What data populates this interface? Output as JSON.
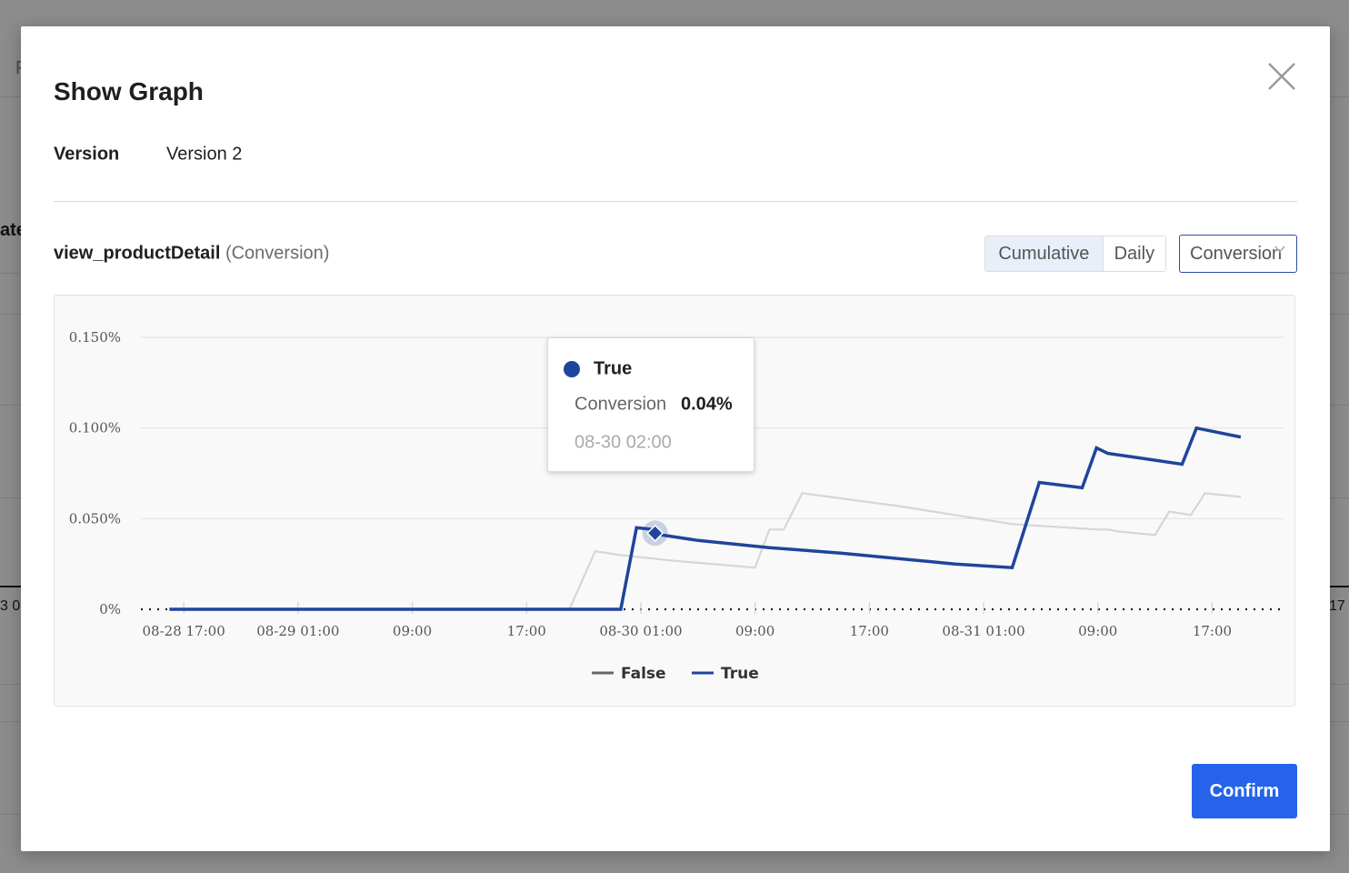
{
  "background": {
    "fragments": [
      "F",
      "ate",
      "3 0",
      "17"
    ]
  },
  "modal": {
    "title": "Show Graph",
    "version_label": "Version",
    "version_value": "Version 2",
    "metric_name": "view_productDetail",
    "metric_type": "(Conversion)",
    "segments": [
      "Cumulative",
      "Daily"
    ],
    "active_segment": "Cumulative",
    "select_value": "Conversion",
    "confirm_label": "Confirm"
  },
  "tooltip": {
    "series": "True",
    "metric": "Conversion",
    "value": "0.04%",
    "time": "08-30 02:00"
  },
  "icons": {
    "close": "close-icon",
    "chevron": "chevron-down-icon",
    "legend_line": "line-marker-icon"
  },
  "colors": {
    "accent": "#2563eb",
    "series_true": "#1f449b",
    "series_false": "#d6d6d6",
    "legend_false": "#666666"
  },
  "chart_data": {
    "type": "line",
    "x_tick_labels": [
      "08-28 17:00",
      "08-29 01:00",
      "09:00",
      "17:00",
      "08-30 01:00",
      "09:00",
      "17:00",
      "08-31 01:00",
      "09:00",
      "17:00"
    ],
    "x_tick_hours": [
      0,
      8,
      16,
      24,
      32,
      40,
      48,
      56,
      64,
      72
    ],
    "xlim": [
      -3,
      77
    ],
    "y_tick_labels": [
      "0%",
      "0.050%",
      "0.100%",
      "0.150%"
    ],
    "y_tick_values": [
      0,
      0.05,
      0.1,
      0.15
    ],
    "ylim": [
      0,
      0.15
    ],
    "x_unit": "hours from 08-28 17:00",
    "legend": [
      "False",
      "True"
    ],
    "legend_position": "bottom-center",
    "grid": true,
    "series": [
      {
        "name": "False",
        "color": "#d6d6d6",
        "points": [
          [
            -1,
            0
          ],
          [
            27,
            0
          ],
          [
            28.8,
            0.032
          ],
          [
            30.5,
            0.03
          ],
          [
            34,
            0.027
          ],
          [
            40,
            0.023
          ],
          [
            41,
            0.044
          ],
          [
            42,
            0.044
          ],
          [
            43.3,
            0.064
          ],
          [
            50,
            0.057
          ],
          [
            58,
            0.047
          ],
          [
            64,
            0.044
          ],
          [
            64.7,
            0.044
          ],
          [
            65.4,
            0.043
          ],
          [
            68,
            0.041
          ],
          [
            69,
            0.054
          ],
          [
            70.5,
            0.052
          ],
          [
            71.5,
            0.064
          ],
          [
            74,
            0.062
          ]
        ]
      },
      {
        "name": "True",
        "color": "#1f449b",
        "points": [
          [
            -1,
            0
          ],
          [
            30.6,
            0
          ],
          [
            31.7,
            0.045
          ],
          [
            32.9,
            0.044
          ],
          [
            33.5,
            0.041
          ],
          [
            36,
            0.038
          ],
          [
            41,
            0.034
          ],
          [
            46,
            0.031
          ],
          [
            54,
            0.025
          ],
          [
            58,
            0.023
          ],
          [
            59.9,
            0.07
          ],
          [
            62.9,
            0.067
          ],
          [
            63.9,
            0.089
          ],
          [
            64.7,
            0.086
          ],
          [
            66.5,
            0.084
          ],
          [
            69.9,
            0.08
          ],
          [
            70.9,
            0.1
          ],
          [
            74,
            0.095
          ]
        ]
      }
    ],
    "highlight": {
      "series": "True",
      "x": 33,
      "y": 0.042
    }
  }
}
